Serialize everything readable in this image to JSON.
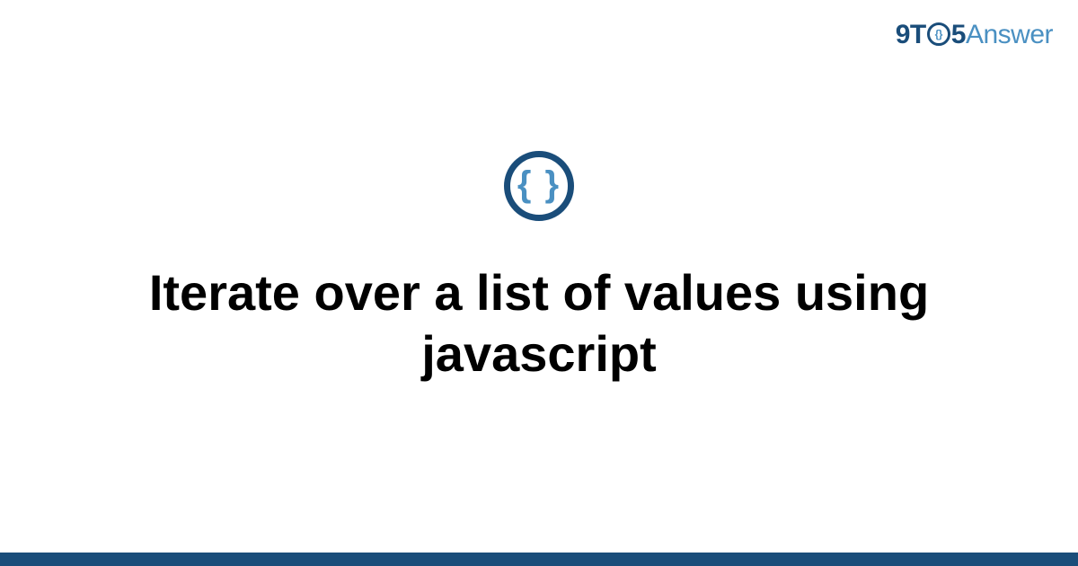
{
  "logo": {
    "part1": "9T",
    "circle_inner": "{}",
    "part2": "5",
    "part3": "Answer"
  },
  "icon": {
    "braces": "{ }"
  },
  "title": "Iterate over a list of values using javascript"
}
